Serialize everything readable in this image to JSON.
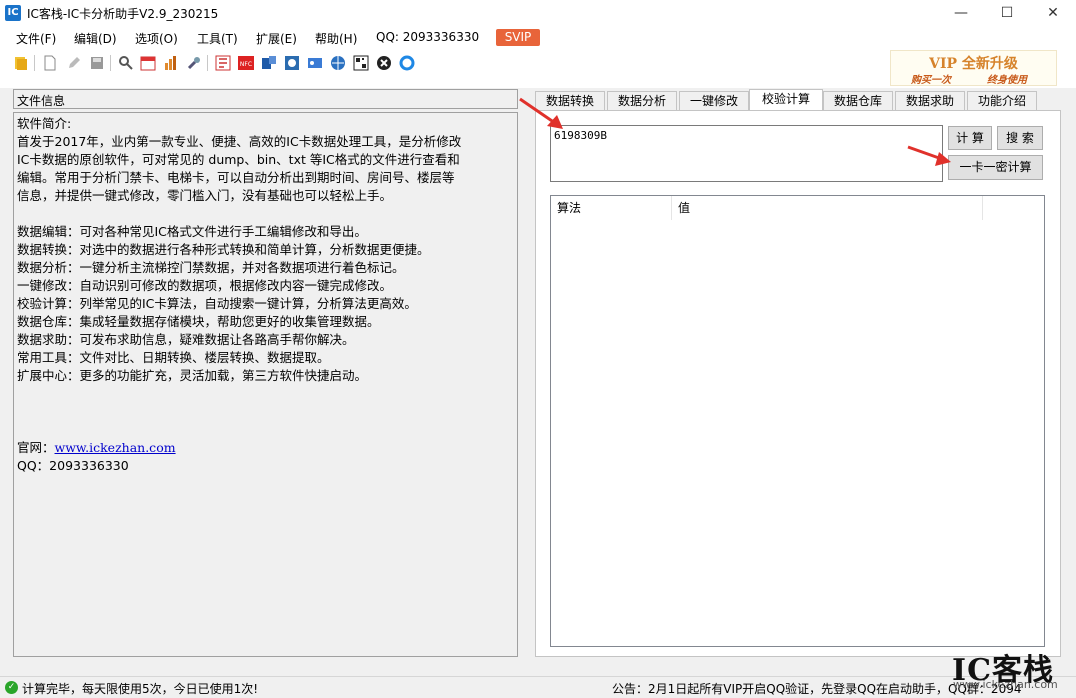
{
  "window": {
    "title": "IC客栈-IC卡分析助手V2.9_230215",
    "app_icon_glyph": "IC",
    "minimize_glyph": "—",
    "maximize_glyph": "☐",
    "close_glyph": "✕"
  },
  "menu": {
    "items": [
      "文件(F)",
      "编辑(D)",
      "选项(O)",
      "工具(T)",
      "扩展(E)",
      "帮助(H)"
    ],
    "qq": "QQ: 2093336330",
    "svip": "SVIP"
  },
  "toolbar": {
    "icons": [
      "open-folder-icon",
      "new-file-icon",
      "edit-icon",
      "save-icon",
      "search-icon",
      "calendar-icon",
      "chart-icon",
      "wrench-icon",
      "nfc-reader-icon",
      "nfc-icon",
      "device-icon",
      "scan-icon",
      "id-card-icon",
      "network-icon",
      "qr-code-icon",
      "plugin-icon",
      "refresh-icon"
    ]
  },
  "vip_banner": {
    "line1": "VIP 全新升级",
    "line2a": "购买一次",
    "line2b": "终身使用"
  },
  "left": {
    "header": "文件信息",
    "lines": [
      "软件简介:",
      "首发于2017年，业内第一款专业、便捷、高效的IC卡数据处理工具，是分析修改",
      "IC卡数据的原创软件，可对常见的 dump、bin、txt 等IC格式的文件进行查看和",
      "编辑。常用于分析门禁卡、电梯卡，可以自动分析出到期时间、房间号、楼层等",
      "信息，并提供一键式修改，零门槛入门，没有基础也可以轻松上手。",
      "",
      "数据编辑：可对各种常见IC格式文件进行手工编辑修改和导出。",
      "数据转换：对选中的数据进行各种形式转换和简单计算，分析数据更便捷。",
      "数据分析：一键分析主流梯控门禁数据，并对各数据项进行着色标记。",
      "一键修改：自动识别可修改的数据项，根据修改内容一键完成修改。",
      "校验计算：列举常见的IC卡算法，自动搜索一键计算，分析算法更高效。",
      "数据仓库：集成轻量数据存储模块，帮助您更好的收集管理数据。",
      "数据求助：可发布求助信息，疑难数据让各路高手帮你解决。",
      "常用工具：文件对比、日期转换、楼层转换、数据提取。",
      "扩展中心：更多的功能扩充，灵活加载，第三方软件快捷启动。",
      "",
      "",
      ""
    ],
    "site_label": "官网：",
    "site_link": "www.ickezhan.com",
    "qq_line": "QQ：2093336330"
  },
  "tabs": [
    "数据转换",
    "数据分析",
    "一键修改",
    "校验计算",
    "数据仓库",
    "数据求助",
    "功能介绍"
  ],
  "active_tab": 3,
  "calc": {
    "input_value": "6198309B",
    "calc_button": "计 算",
    "search_button": "搜 索",
    "one_card_button": "一卡一密计算",
    "col_algorithm": "算法",
    "col_value": "值"
  },
  "status": {
    "left": "计算完毕，每天限使用5次，今日已使用1次!",
    "right": "公告：2月1日起所有VIP开启QQ验证，先登录QQ在启动助手，QQ群：2094"
  },
  "watermark": {
    "big": "IC客栈",
    "small": "www.ickezhan.com"
  },
  "colors": {
    "accent_red": "#e0312b",
    "svip": "#e8643a",
    "status_ok": "#2aa52a"
  }
}
